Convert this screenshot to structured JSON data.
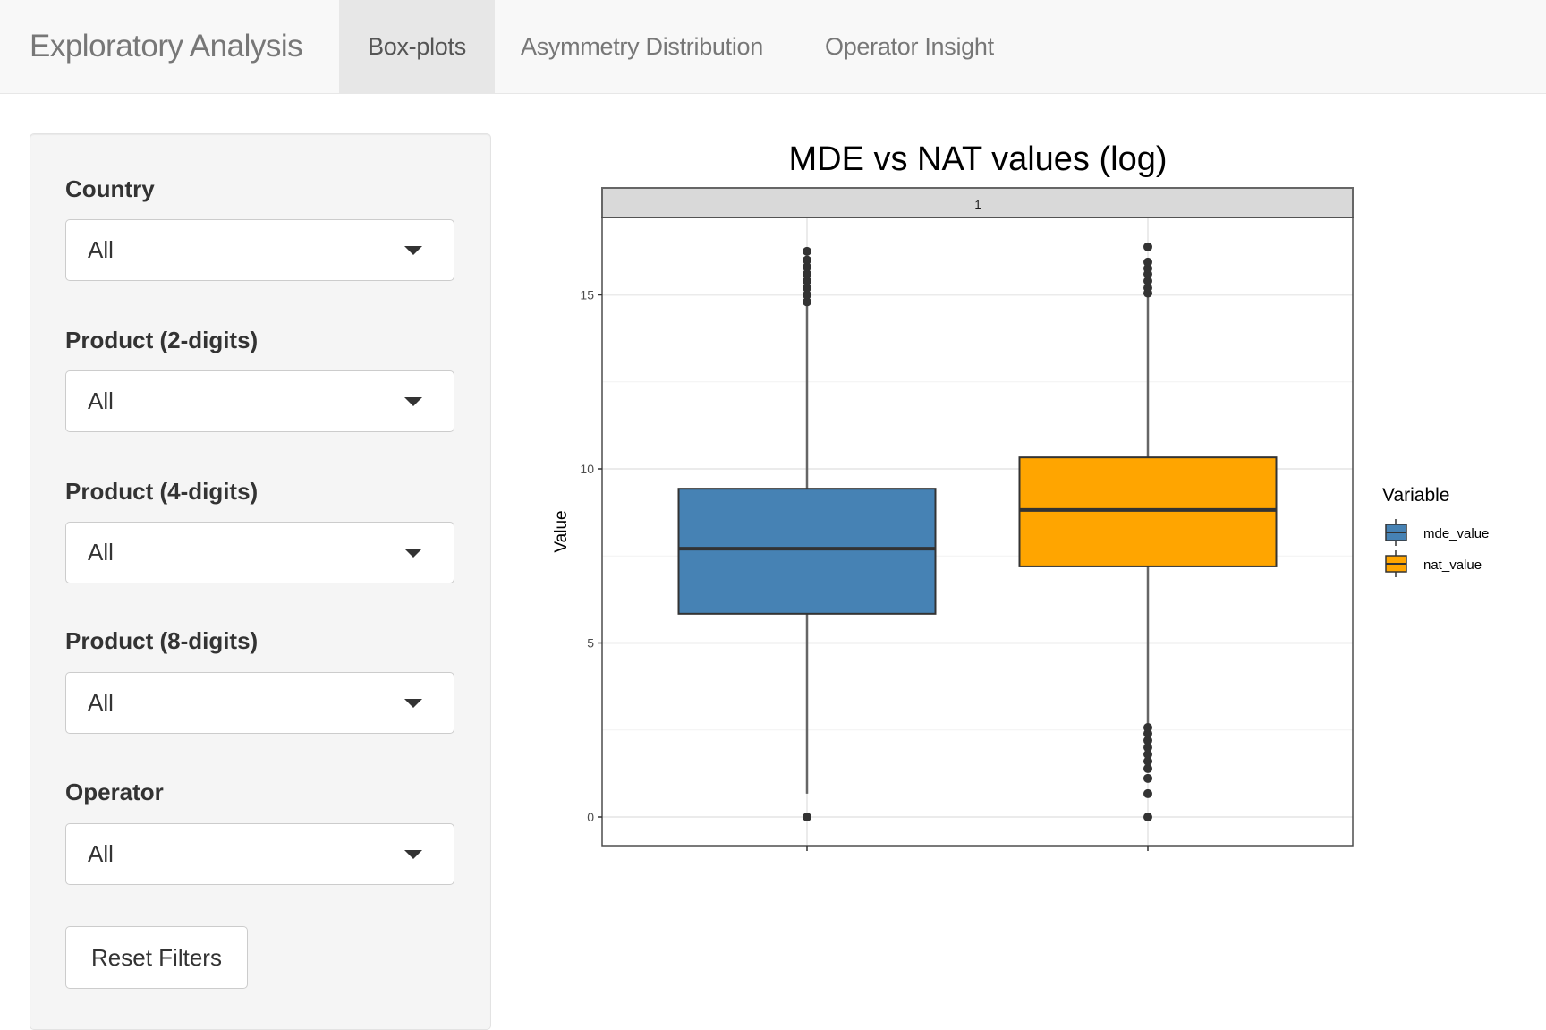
{
  "navbar": {
    "brand": "Exploratory Analysis",
    "tabs": [
      {
        "label": "Box-plots",
        "active": true
      },
      {
        "label": "Asymmetry Distribution",
        "active": false
      },
      {
        "label": "Operator Insight",
        "active": false
      }
    ]
  },
  "sidebar": {
    "filters": [
      {
        "label": "Country",
        "value": "All"
      },
      {
        "label": "Product (2-digits)",
        "value": "All"
      },
      {
        "label": "Product (4-digits)",
        "value": "All"
      },
      {
        "label": "Product (8-digits)",
        "value": "All"
      },
      {
        "label": "Operator",
        "value": "All"
      }
    ],
    "reset_label": "Reset Filters"
  },
  "colors": {
    "mde": "#4682B4",
    "nat": "#FFA500",
    "outline": "#333333"
  },
  "chart_data": {
    "type": "box",
    "title": "MDE vs NAT values (log)",
    "facet_label": "1",
    "xlabel": "",
    "ylabel": "Value",
    "ylim": [
      -0.8,
      16.8
    ],
    "yticks": [
      0,
      5,
      10,
      15
    ],
    "grid": true,
    "legend": {
      "title": "Variable",
      "position": "right"
    },
    "series": [
      {
        "name": "mde_value",
        "color": "#4682B4",
        "whisker_low": 0.67,
        "q1": 5.84,
        "median": 7.71,
        "q3": 9.43,
        "whisker_high": 14.73,
        "outliers": [
          0,
          14.8,
          15.0,
          15.2,
          15.4,
          15.6,
          15.8,
          16.0,
          16.25
        ]
      },
      {
        "name": "nat_value",
        "color": "#FFA500",
        "whisker_low": 2.57,
        "q1": 7.2,
        "median": 8.82,
        "q3": 10.33,
        "whisker_high": 15.0,
        "outliers": [
          0,
          0.67,
          1.11,
          1.39,
          1.6,
          1.8,
          2.0,
          2.2,
          2.4,
          2.57,
          15.05,
          15.2,
          15.4,
          15.6,
          15.76,
          15.94,
          16.38
        ]
      }
    ]
  }
}
